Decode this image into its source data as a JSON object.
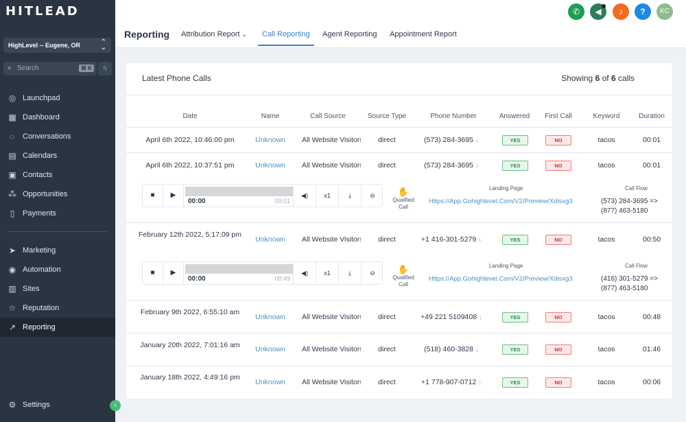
{
  "brand": {
    "logo": "HITLEAD"
  },
  "sidebar": {
    "location": "HighLevel -- Eugene, OR",
    "search_placeholder": "Search",
    "search_shortcut": "⌘ K",
    "items": [
      {
        "label": "Launchpad",
        "icon": "rocket-icon"
      },
      {
        "label": "Dashboard",
        "icon": "dashboard-icon"
      },
      {
        "label": "Conversations",
        "icon": "chat-icon"
      },
      {
        "label": "Calendars",
        "icon": "calendar-icon"
      },
      {
        "label": "Contacts",
        "icon": "contacts-icon"
      },
      {
        "label": "Opportunities",
        "icon": "opportunities-icon"
      },
      {
        "label": "Payments",
        "icon": "payments-icon"
      },
      {
        "label": "Marketing",
        "icon": "send-icon"
      },
      {
        "label": "Automation",
        "icon": "automation-icon"
      },
      {
        "label": "Sites",
        "icon": "sites-icon"
      },
      {
        "label": "Reputation",
        "icon": "star-icon"
      },
      {
        "label": "Reporting",
        "icon": "chart-icon",
        "active": true
      }
    ],
    "settings": "Settings"
  },
  "header": {
    "title": "Reporting",
    "tabs": [
      "Attribution Report",
      "Call Reporting",
      "Agent Reporting",
      "Appointment Report"
    ],
    "active_tab": "Call Reporting",
    "avatar": "KC",
    "colors": {
      "phone": "#1f9d57",
      "announce": "#2f7d5a",
      "bell": "#f26b22",
      "help": "#1e88e5",
      "avatar": "#8fbc8f"
    }
  },
  "card": {
    "title": "Latest Phone Calls",
    "showing_prefix": "Showing",
    "showing_count": "6",
    "showing_of": "of",
    "showing_total": "6",
    "showing_suffix": "calls",
    "columns": [
      "Date",
      "Name",
      "Call Source",
      "Source Type",
      "Phone Number",
      "Answered",
      "First Call",
      "Keyword",
      "Duration"
    ],
    "rows": [
      {
        "date": "April 6th 2022, 10:46:00 pm",
        "name": "Unknown",
        "source": "All Website Visitors",
        "type": "direct",
        "phone": "(573) 284-3695",
        "answered": "YES",
        "first": "NO",
        "keyword": "tacos",
        "duration": "00:01"
      },
      {
        "date": "April 6th 2022, 10:37:51 pm",
        "name": "Unknown",
        "source": "All Website Visitors",
        "type": "direct",
        "phone": "(573) 284-3695",
        "answered": "YES",
        "first": "NO",
        "keyword": "tacos",
        "duration": "00:01"
      },
      {
        "date": "February 12th 2022, 5:17:09 pm",
        "name": "Unknown",
        "source": "All Website Visitors",
        "type": "direct",
        "phone": "+1 416-301-5279",
        "answered": "YES",
        "first": "NO",
        "keyword": "tacos",
        "duration": "00:50"
      },
      {
        "date": "February 9th 2022, 6:55:10 am",
        "name": "Unknown",
        "source": "All Website Visitors",
        "type": "direct",
        "phone": "+49 221 5109408",
        "answered": "YES",
        "first": "NO",
        "keyword": "tacos",
        "duration": "00:48"
      },
      {
        "date": "January 20th 2022, 7:01:16 am",
        "name": "Unknown",
        "source": "All Website Visitors",
        "type": "direct",
        "phone": "(518) 460-3828",
        "answered": "YES",
        "first": "NO",
        "keyword": "tacos",
        "duration": "01:46"
      },
      {
        "date": "January 18th 2022, 4:49:16 pm",
        "name": "Unknown",
        "source": "All Website Visitors",
        "type": "direct",
        "phone": "+1 778-907-0712",
        "answered": "YES",
        "first": "NO",
        "keyword": "tacos",
        "duration": "00:06"
      }
    ],
    "players": [
      {
        "current": "00:00",
        "duration": "00:01",
        "speed": "x1",
        "qualified": "Qualified Call",
        "landing_label": "Landing Page",
        "landing_url": "Https://App.Gohighlevel.Com/V2/Preview/Xdisxg3",
        "flow_label": "Call Flow",
        "flow_from": "(573) 284-3695 =>",
        "flow_to": "(877) 463-5180"
      },
      {
        "current": "00:00",
        "duration": "00:49",
        "speed": "x1",
        "qualified": "Qualified Call",
        "landing_label": "Landing Page",
        "landing_url": "Https://App.Gohighlevel.Com/V2/Preview/Xdisxg3",
        "flow_label": "Call Flow",
        "flow_from": "(416) 301-5279 =>",
        "flow_to": "(877) 463-5180"
      }
    ]
  }
}
